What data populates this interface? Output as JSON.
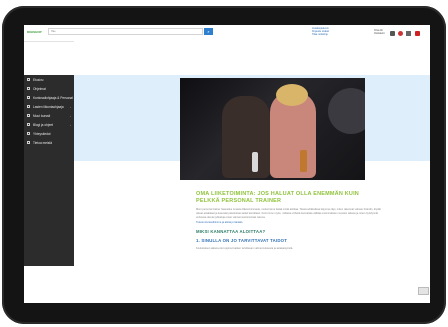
{
  "topbar": {
    "logo": "DIGISHOP",
    "search_placeholder": "Hae",
    "search_button": "⌕",
    "links": [
      "Asiakaspalvelu",
      "Kirjaudu sisään",
      "Tilaa uutiskirje"
    ],
    "account_label": "Oma tili Ostoskori"
  },
  "sidebar": {
    "items": [
      {
        "label": "Etusivu",
        "chevron": ""
      },
      {
        "label": "Ohjelmat",
        "chevron": ""
      },
      {
        "label": "Kuntosaliohjaaja & Personal",
        "chevron": "›"
      },
      {
        "label": "Lasten liikuntaohjaaja",
        "chevron": "›"
      },
      {
        "label": "Muut kurssit",
        "chevron": "›"
      },
      {
        "label": "Blogi ja ohjeet",
        "chevron": "›"
      },
      {
        "label": "Yhteystiedot",
        "chevron": ""
      },
      {
        "label": "Tietoa meistä",
        "chevron": ""
      }
    ]
  },
  "article": {
    "heading": "OMA LIIKETOIMINTA: JOS HALUAT OLLA ENEMMÄN KUIN PELKKÄ PERSONAL TRAINER",
    "paragraph": "Moni personal trainer haaveilee omasta liiketoiminnasta, mutta harva tietää mistä aloittaa. Tässä artikkelissa käymme läpi, miten rakennat vahvan brändin, löydät oikeat asiakkaat ja kasvatat palveluitasi askel kerrallaan. Kerromme myös, millaisia virheitä kannattaa välttää ensimmäisten vuosien aikana ja miten hyödynnät verkossa olevia työkaluja oman valmennustoimintasi tukena.",
    "link": "Tutustu kursseihimme ja aloita jo tänään.",
    "subheading": "MIKSI KANNATTAA ALOITTAA?",
    "point": "1. SINULLA ON JO TARVITTAVAT TAIDOT",
    "point_text": "Koulutuksen aikana olet oppinut kaiken tarvittavan valmennuksesta ja asiakastyöstä."
  },
  "colors": {
    "accent_green": "#8fc23b",
    "link_blue": "#2f6fb6",
    "sidebar": "#2c2c2c",
    "hero_band": "#dfeefb"
  }
}
